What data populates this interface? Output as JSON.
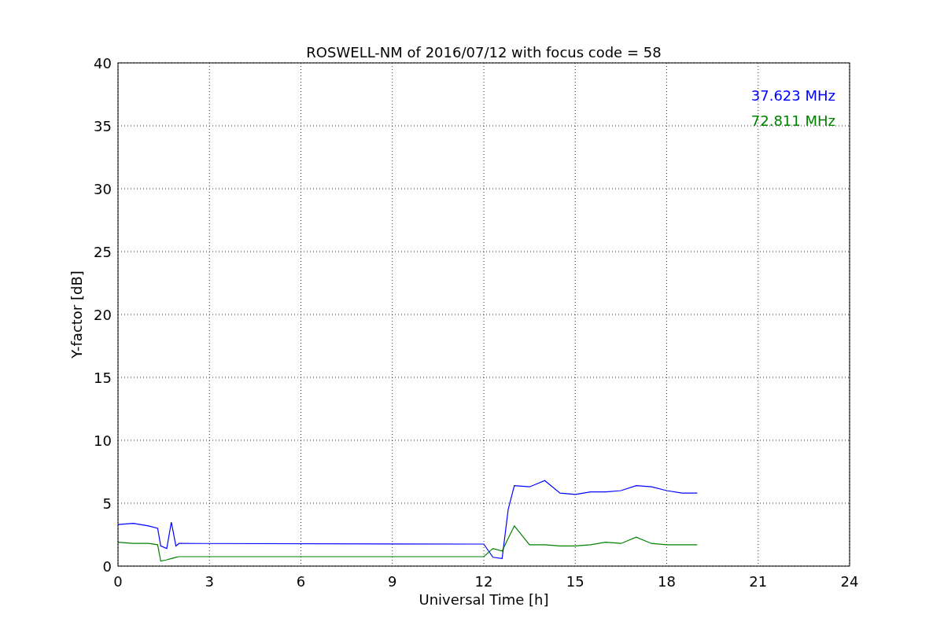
{
  "chart_data": {
    "type": "line",
    "title": "ROSWELL-NM of 2016/07/12 with focus code = 58",
    "xlabel": "Universal Time [h]",
    "ylabel": "Y-factor [dB]",
    "x": [
      0,
      0.5,
      1,
      1.3,
      1.4,
      1.6,
      1.75,
      1.9,
      2,
      12,
      12.3,
      12.6,
      12.8,
      13,
      13.5,
      14,
      14.5,
      15,
      15.5,
      16,
      16.5,
      17,
      17.5,
      18,
      18.5,
      19
    ],
    "series": [
      {
        "name": "37.623 MHz",
        "color": "#0000ff",
        "values": [
          3.3,
          3.4,
          3.2,
          3.0,
          1.6,
          1.4,
          3.5,
          1.6,
          1.8,
          1.75,
          0.7,
          0.6,
          4.5,
          6.4,
          6.3,
          6.8,
          5.8,
          5.7,
          5.9,
          5.9,
          6.0,
          6.4,
          6.3,
          6.0,
          5.8,
          5.8
        ]
      },
      {
        "name": "72.811 MHz",
        "color": "#008000",
        "values": [
          1.9,
          1.8,
          1.8,
          1.7,
          0.4,
          0.5,
          0.6,
          0.7,
          0.75,
          0.75,
          1.4,
          1.2,
          2.2,
          3.2,
          1.7,
          1.7,
          1.6,
          1.6,
          1.7,
          1.9,
          1.8,
          2.3,
          1.8,
          1.7,
          1.7,
          1.7
        ]
      }
    ],
    "xlim": [
      0,
      24
    ],
    "ylim": [
      0,
      40
    ],
    "xticks": [
      0,
      3,
      6,
      9,
      12,
      15,
      18,
      21,
      24
    ],
    "yticks": [
      0,
      5,
      10,
      15,
      20,
      25,
      30,
      35,
      40
    ],
    "grid": true
  }
}
